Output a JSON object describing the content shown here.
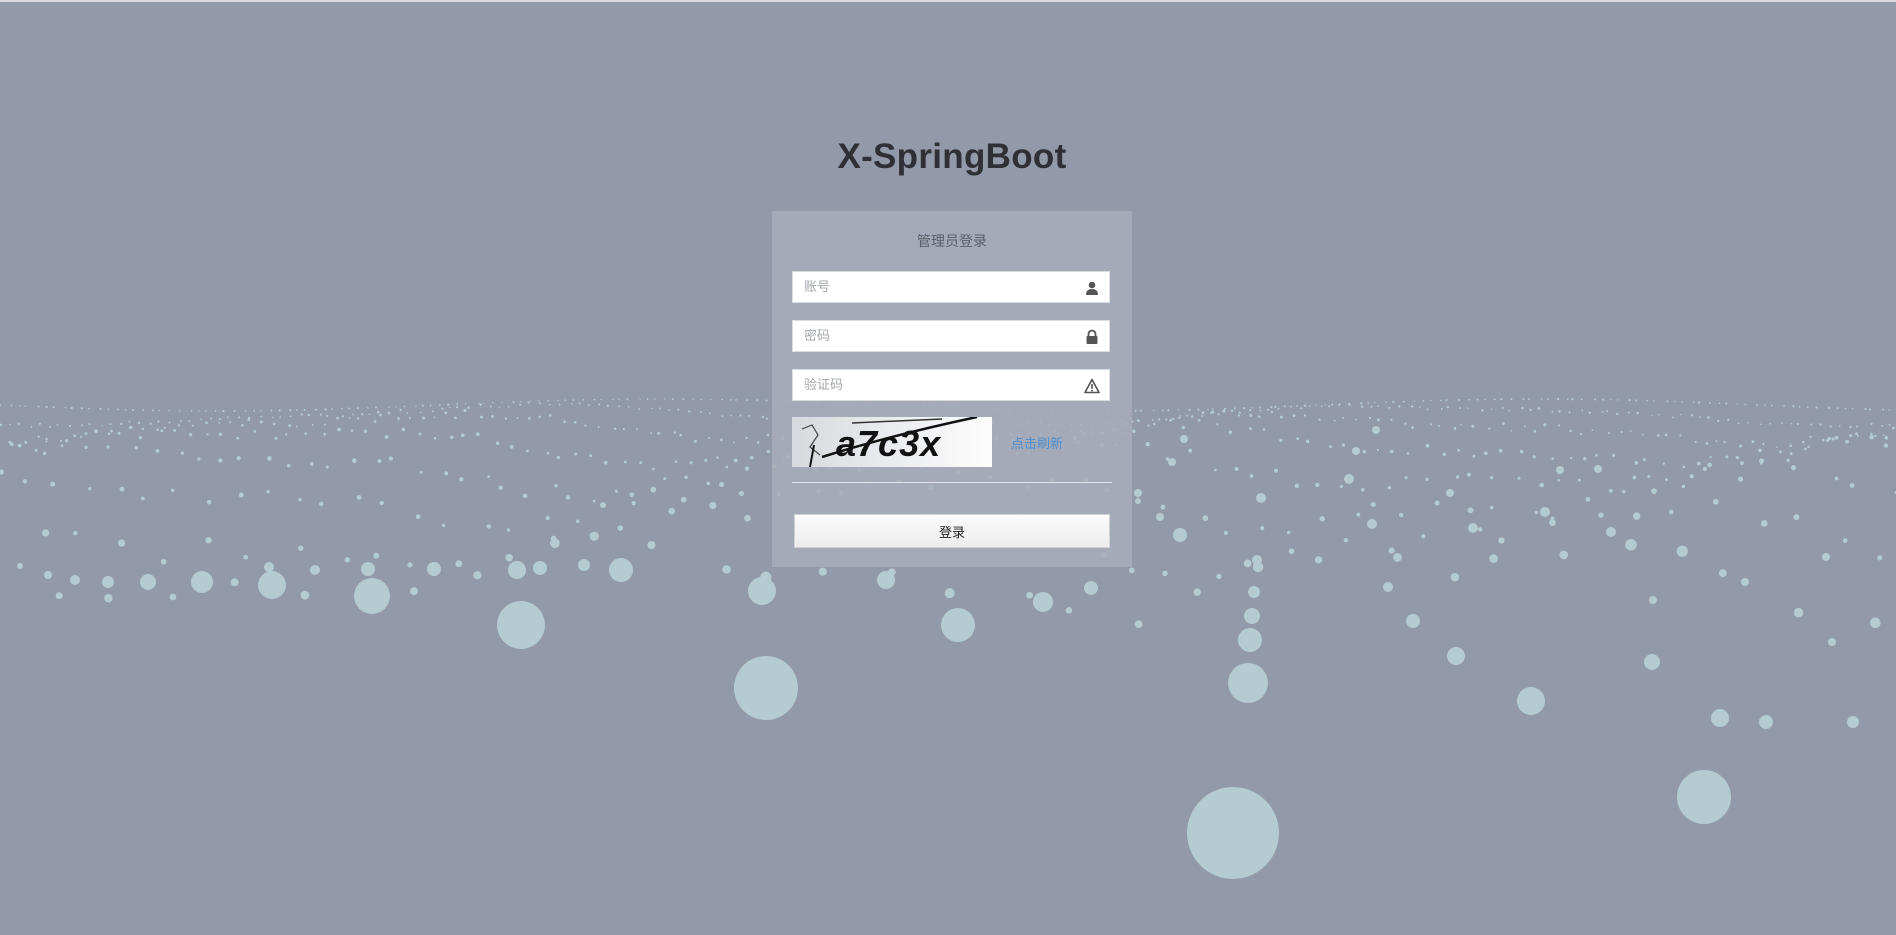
{
  "page": {
    "title": "X-SpringBoot",
    "background_color": "#9299a8",
    "particle_color": "#b4cbd2"
  },
  "login": {
    "heading": "管理员登录",
    "username": {
      "placeholder": "账号",
      "value": "",
      "icon": "user-icon"
    },
    "password": {
      "placeholder": "密码",
      "value": "",
      "icon": "lock-icon"
    },
    "captcha_input": {
      "placeholder": "验证码",
      "value": "",
      "icon": "warning-icon"
    },
    "captcha_image_text": "a7c3x",
    "refresh_label": "点击刷新",
    "submit_label": "登录"
  }
}
